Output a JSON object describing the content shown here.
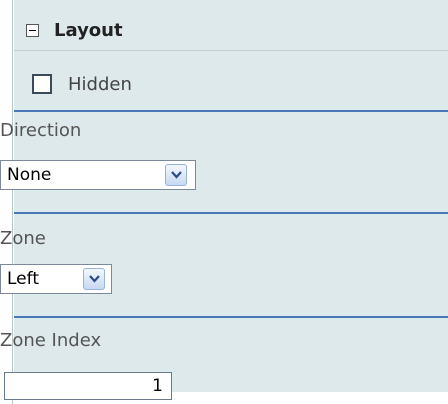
{
  "layout_section": {
    "title": "Layout",
    "collapse_icon": "minus-box-icon"
  },
  "hidden": {
    "label": "Hidden",
    "checked": false
  },
  "direction": {
    "label": "Direction",
    "value": "None",
    "dropdown_icon": "chevron-down-icon"
  },
  "zone": {
    "label": "Zone",
    "value": "Left",
    "dropdown_icon": "chevron-down-icon"
  },
  "zone_index": {
    "label": "Zone Index",
    "value": "1"
  },
  "colors": {
    "panel_bg": "#dde9ea",
    "separator": "#4a78b8"
  }
}
